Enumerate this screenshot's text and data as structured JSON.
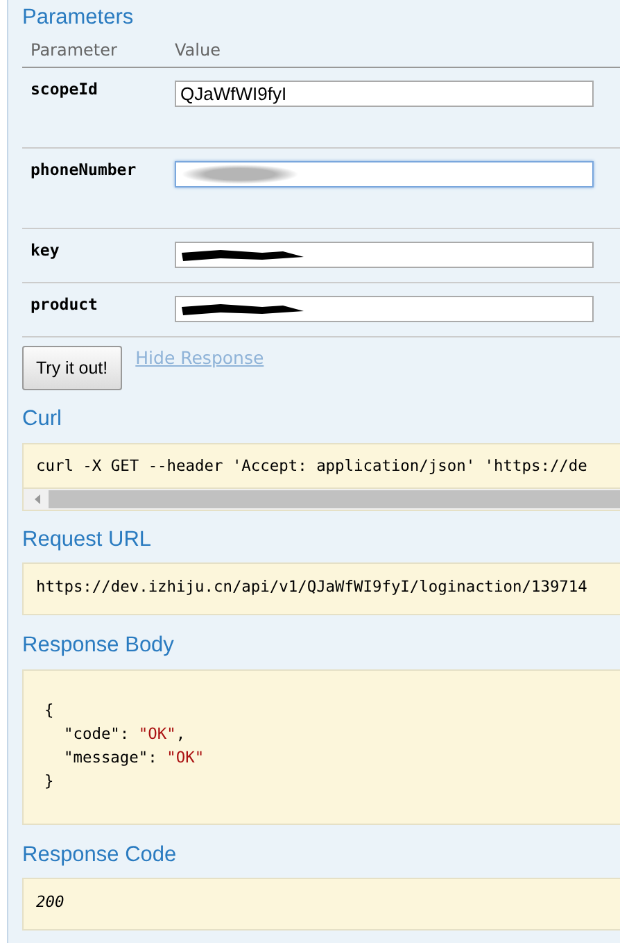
{
  "parameters": {
    "title": "Parameters",
    "columns": [
      "Parameter",
      "Value"
    ],
    "rows": [
      {
        "name": "scopeId",
        "value": "QJaWfWI9fyI",
        "focused": false,
        "kind": "plain"
      },
      {
        "name": "phoneNumber",
        "focused": true,
        "kind": "blurred"
      },
      {
        "name": "key",
        "focused": false,
        "kind": "scribbled"
      },
      {
        "name": "product",
        "focused": false,
        "kind": "scribbled"
      }
    ]
  },
  "try_button": "Try it out!",
  "hide_response_link": "Hide Response",
  "curl": {
    "title": "Curl",
    "text": "curl -X GET --header 'Accept: application/json' 'https://de"
  },
  "request_url": {
    "title": "Request URL",
    "text": "https://dev.izhiju.cn/api/v1/QJaWfWI9fyI/loginaction/139714"
  },
  "response_body": {
    "title": "Response Body",
    "open": "{",
    "entries": [
      {
        "key": "\"code\"",
        "sep": ": ",
        "value": "\"OK\"",
        "comma": ","
      },
      {
        "key": "\"message\"",
        "sep": ": ",
        "value": "\"OK\""
      }
    ],
    "close": "}"
  },
  "response_code": {
    "title": "Response Code",
    "text": "200"
  }
}
